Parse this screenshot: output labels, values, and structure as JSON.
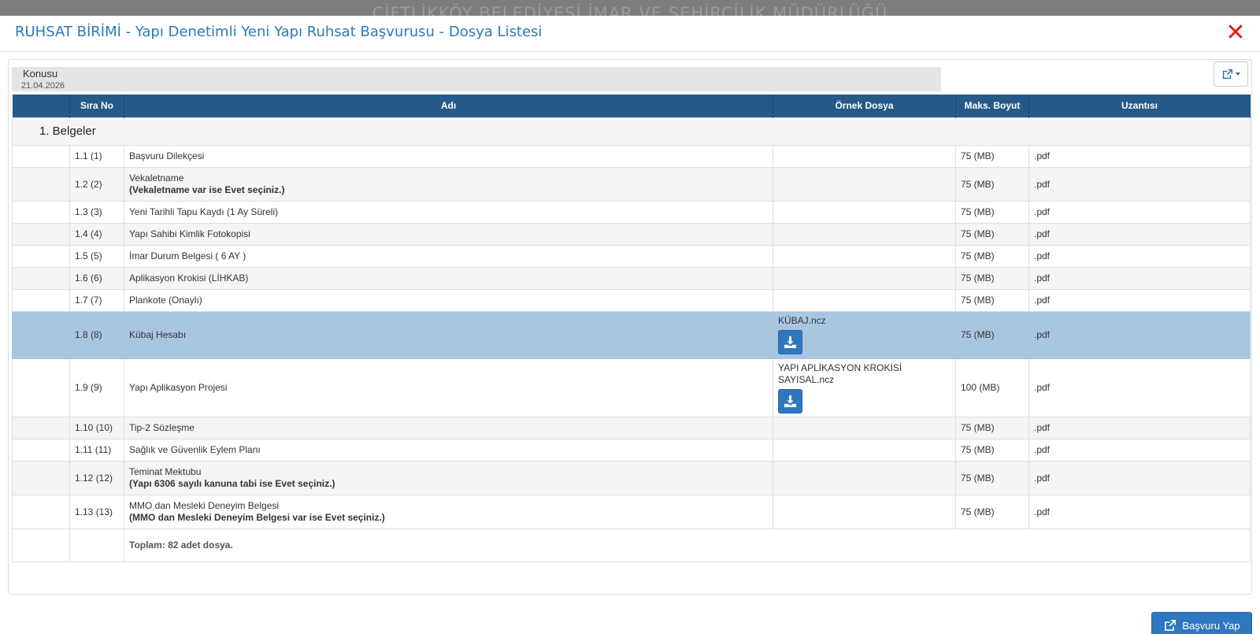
{
  "background_title": "ÇİFTLİKKÖY BELEDİYESİ İMAR VE ŞEHİRCİLİK MÜDÜRLÜĞÜ",
  "modal": {
    "title": "RUHSAT BİRİMİ - Yapı Denetimli Yeni Yapı Ruhsat Başvurusu - Dosya Listesi",
    "close_symbol": "✕",
    "accent_color": "#2b7ab8",
    "close_color": "#d9201a"
  },
  "konusu": {
    "label": "Konusu",
    "value": "21.04.2026"
  },
  "export_icon": "export-icon",
  "table": {
    "header_color": "#255a88",
    "selected_row_color": "#a9c6e1",
    "columns": [
      "",
      "Sıra No",
      "Adı",
      "Örnek Dosya",
      "Maks. Boyut",
      "Uzantısı"
    ],
    "group_label": "1. Belgeler",
    "rows": [
      {
        "no": "1.1 (1)",
        "name": "Başvuru Dilekçesi",
        "note": "",
        "sample": "",
        "size": "75 (MB)",
        "ext": ".pdf"
      },
      {
        "no": "1.2 (2)",
        "name": "Vekaletname",
        "note": "(Vekaletname var ise Evet seçiniz.)",
        "sample": "",
        "size": "75 (MB)",
        "ext": ".pdf"
      },
      {
        "no": "1.3 (3)",
        "name": "Yeni Tarihli Tapu Kaydı (1 Ay Süreli)",
        "note": "",
        "sample": "",
        "size": "75 (MB)",
        "ext": ".pdf"
      },
      {
        "no": "1.4 (4)",
        "name": "Yapı Sahibi Kimlik Fotokopisi",
        "note": "",
        "sample": "",
        "size": "75 (MB)",
        "ext": ".pdf"
      },
      {
        "no": "1.5 (5)",
        "name": "İmar Durum Belgesi ( 6 AY )",
        "note": "",
        "sample": "",
        "size": "75 (MB)",
        "ext": ".pdf"
      },
      {
        "no": "1.6 (6)",
        "name": "Aplikasyon Krokisi (LİHKAB)",
        "note": "",
        "sample": "",
        "size": "75 (MB)",
        "ext": ".pdf"
      },
      {
        "no": "1.7 (7)",
        "name": "Plankote (Onaylı)",
        "note": "",
        "sample": "",
        "size": "75 (MB)",
        "ext": ".pdf"
      },
      {
        "no": "1.8 (8)",
        "name": "Kübaj Hesabı",
        "note": "",
        "sample": "KÜBAJ.ncz",
        "size": "75 (MB)",
        "ext": ".pdf",
        "selected": true
      },
      {
        "no": "1.9 (9)",
        "name": "Yapı Aplikasyon Projesi",
        "note": "",
        "sample": "YAPI APLİKASYON KROKİSİ SAYISAL.ncz",
        "size": "100 (MB)",
        "ext": ".pdf"
      },
      {
        "no": "1.10 (10)",
        "name": "Tip-2 Sözleşme",
        "note": "",
        "sample": "",
        "size": "75 (MB)",
        "ext": ".pdf"
      },
      {
        "no": "1.11 (11)",
        "name": "Sağlık ve Güvenlik Eylem Planı",
        "note": "",
        "sample": "",
        "size": "75 (MB)",
        "ext": ".pdf"
      },
      {
        "no": "1.12 (12)",
        "name": "Teminat Mektubu",
        "note": "(Yapı 6306 sayılı kanuna tabi ise Evet seçiniz.)",
        "sample": "",
        "size": "75 (MB)",
        "ext": ".pdf"
      },
      {
        "no": "1.13 (13)",
        "name": "MMO dan Mesleki Deneyim Belgesi",
        "note": "(MMO dan Mesleki Deneyim Belgesi var ise Evet seçiniz.)",
        "sample": "",
        "size": "75 (MB)",
        "ext": ".pdf"
      }
    ],
    "footer_total": "Toplam: 82 adet dosya."
  },
  "apply_button": {
    "label": "Başvuru Yap",
    "icon": "external-link-icon"
  }
}
